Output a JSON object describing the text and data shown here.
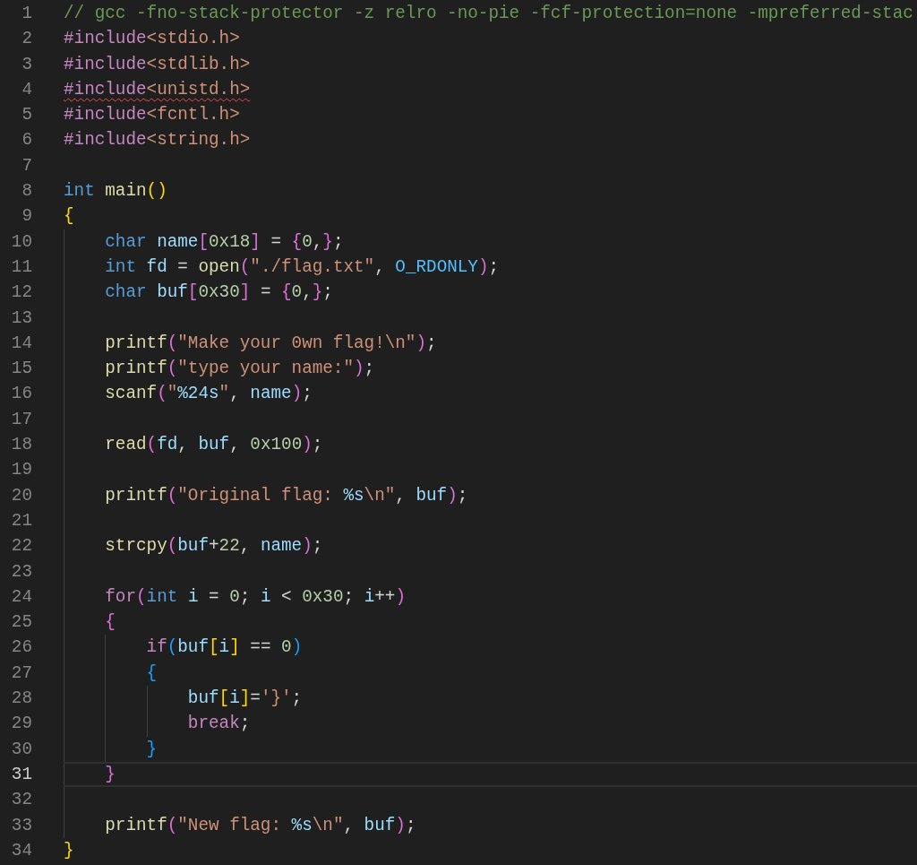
{
  "editor": {
    "lines": [
      {
        "number": "1",
        "current": false,
        "tokens": [
          {
            "kind": "comment",
            "text": "// gcc -fno-stack-protector -z relro -no-pie -fcf-protection=none -mpreferred-stac"
          }
        ]
      },
      {
        "number": "2",
        "current": false,
        "tokens": [
          {
            "kind": "directive",
            "text": "#include"
          },
          {
            "kind": "string",
            "text": "<stdio.h>"
          }
        ]
      },
      {
        "number": "3",
        "current": false,
        "tokens": [
          {
            "kind": "directive",
            "text": "#include"
          },
          {
            "kind": "string",
            "text": "<stdlib.h>"
          }
        ]
      },
      {
        "number": "4",
        "current": false,
        "tokens": [
          {
            "kind": "directive",
            "text": "#include",
            "error": true
          },
          {
            "kind": "string",
            "text": "<unistd.h>",
            "error": true
          }
        ]
      },
      {
        "number": "5",
        "current": false,
        "tokens": [
          {
            "kind": "directive",
            "text": "#include"
          },
          {
            "kind": "string",
            "text": "<fcntl.h>"
          }
        ]
      },
      {
        "number": "6",
        "current": false,
        "tokens": [
          {
            "kind": "directive",
            "text": "#include"
          },
          {
            "kind": "string",
            "text": "<string.h>"
          }
        ]
      },
      {
        "number": "7",
        "current": false
      },
      {
        "number": "8",
        "current": false,
        "tokens": [
          {
            "kind": "type",
            "text": "int "
          },
          {
            "kind": "function",
            "text": "main"
          },
          {
            "kind": "bracket1",
            "text": "()"
          }
        ]
      },
      {
        "number": "9",
        "current": false,
        "tokens": [
          {
            "kind": "bracket1",
            "text": "{"
          }
        ]
      },
      {
        "number": "10",
        "current": false,
        "tokens": [
          {
            "kind": "type",
            "text": "    char "
          },
          {
            "kind": "variable",
            "text": "name"
          },
          {
            "kind": "bracket2",
            "text": "["
          },
          {
            "kind": "number",
            "text": "0x18"
          },
          {
            "kind": "bracket2",
            "text": "]"
          },
          {
            "kind": "plain",
            "text": " = "
          },
          {
            "kind": "bracket2",
            "text": "{"
          },
          {
            "kind": "number",
            "text": "0"
          },
          {
            "kind": "plain",
            "text": ","
          },
          {
            "kind": "bracket2",
            "text": "}"
          },
          {
            "kind": "plain",
            "text": ";"
          }
        ]
      },
      {
        "number": "11",
        "current": false,
        "tokens": [
          {
            "kind": "type",
            "text": "    int "
          },
          {
            "kind": "variable",
            "text": "fd"
          },
          {
            "kind": "plain",
            "text": " = "
          },
          {
            "kind": "function",
            "text": "open"
          },
          {
            "kind": "bracket2",
            "text": "("
          },
          {
            "kind": "string",
            "text": "\"./flag.txt\""
          },
          {
            "kind": "plain",
            "text": ", "
          },
          {
            "kind": "constant",
            "text": "O_RDONLY"
          },
          {
            "kind": "bracket2",
            "text": ")"
          },
          {
            "kind": "plain",
            "text": ";"
          }
        ]
      },
      {
        "number": "12",
        "current": false,
        "tokens": [
          {
            "kind": "type",
            "text": "    char "
          },
          {
            "kind": "variable",
            "text": "buf"
          },
          {
            "kind": "bracket2",
            "text": "["
          },
          {
            "kind": "number",
            "text": "0x30"
          },
          {
            "kind": "bracket2",
            "text": "]"
          },
          {
            "kind": "plain",
            "text": " = "
          },
          {
            "kind": "bracket2",
            "text": "{"
          },
          {
            "kind": "number",
            "text": "0"
          },
          {
            "kind": "plain",
            "text": ","
          },
          {
            "kind": "bracket2",
            "text": "}"
          },
          {
            "kind": "plain",
            "text": ";"
          }
        ]
      },
      {
        "number": "13",
        "current": false
      },
      {
        "number": "14",
        "current": false,
        "tokens": [
          {
            "kind": "function",
            "text": "    printf"
          },
          {
            "kind": "bracket2",
            "text": "("
          },
          {
            "kind": "string",
            "text": "\"Make your 0wn flag!\\n\""
          },
          {
            "kind": "bracket2",
            "text": ")"
          },
          {
            "kind": "plain",
            "text": ";"
          }
        ]
      },
      {
        "number": "15",
        "current": false,
        "tokens": [
          {
            "kind": "function",
            "text": "    printf"
          },
          {
            "kind": "bracket2",
            "text": "("
          },
          {
            "kind": "string",
            "text": "\"type your name:\""
          },
          {
            "kind": "bracket2",
            "text": ")"
          },
          {
            "kind": "plain",
            "text": ";"
          }
        ]
      },
      {
        "number": "16",
        "current": false,
        "tokens": [
          {
            "kind": "function",
            "text": "    scanf"
          },
          {
            "kind": "bracket2",
            "text": "("
          },
          {
            "kind": "string",
            "text": "\""
          },
          {
            "kind": "format",
            "text": "%24s"
          },
          {
            "kind": "string",
            "text": "\""
          },
          {
            "kind": "plain",
            "text": ", "
          },
          {
            "kind": "variable",
            "text": "name"
          },
          {
            "kind": "bracket2",
            "text": ")"
          },
          {
            "kind": "plain",
            "text": ";"
          }
        ]
      },
      {
        "number": "17",
        "current": false
      },
      {
        "number": "18",
        "current": false,
        "tokens": [
          {
            "kind": "function",
            "text": "    read"
          },
          {
            "kind": "bracket2",
            "text": "("
          },
          {
            "kind": "variable",
            "text": "fd"
          },
          {
            "kind": "plain",
            "text": ", "
          },
          {
            "kind": "variable",
            "text": "buf"
          },
          {
            "kind": "plain",
            "text": ", "
          },
          {
            "kind": "number",
            "text": "0x100"
          },
          {
            "kind": "bracket2",
            "text": ")"
          },
          {
            "kind": "plain",
            "text": ";"
          }
        ]
      },
      {
        "number": "19",
        "current": false
      },
      {
        "number": "20",
        "current": false,
        "tokens": [
          {
            "kind": "function",
            "text": "    printf"
          },
          {
            "kind": "bracket2",
            "text": "("
          },
          {
            "kind": "string",
            "text": "\"Original flag: "
          },
          {
            "kind": "format",
            "text": "%s"
          },
          {
            "kind": "string",
            "text": "\\n\""
          },
          {
            "kind": "plain",
            "text": ", "
          },
          {
            "kind": "variable",
            "text": "buf"
          },
          {
            "kind": "bracket2",
            "text": ")"
          },
          {
            "kind": "plain",
            "text": ";"
          }
        ]
      },
      {
        "number": "21",
        "current": false
      },
      {
        "number": "22",
        "current": false,
        "tokens": [
          {
            "kind": "function",
            "text": "    strcpy"
          },
          {
            "kind": "bracket2",
            "text": "("
          },
          {
            "kind": "variable",
            "text": "buf"
          },
          {
            "kind": "plain",
            "text": "+"
          },
          {
            "kind": "number",
            "text": "22"
          },
          {
            "kind": "plain",
            "text": ", "
          },
          {
            "kind": "variable",
            "text": "name"
          },
          {
            "kind": "bracket2",
            "text": ")"
          },
          {
            "kind": "plain",
            "text": ";"
          }
        ]
      },
      {
        "number": "23",
        "current": false
      },
      {
        "number": "24",
        "current": false,
        "tokens": [
          {
            "kind": "control",
            "text": "    for"
          },
          {
            "kind": "bracket2",
            "text": "("
          },
          {
            "kind": "type",
            "text": "int "
          },
          {
            "kind": "variable",
            "text": "i"
          },
          {
            "kind": "plain",
            "text": " = "
          },
          {
            "kind": "number",
            "text": "0"
          },
          {
            "kind": "plain",
            "text": "; "
          },
          {
            "kind": "variable",
            "text": "i"
          },
          {
            "kind": "plain",
            "text": " < "
          },
          {
            "kind": "number",
            "text": "0x30"
          },
          {
            "kind": "plain",
            "text": "; "
          },
          {
            "kind": "variable",
            "text": "i"
          },
          {
            "kind": "plain",
            "text": "++"
          },
          {
            "kind": "bracket2",
            "text": ")"
          }
        ]
      },
      {
        "number": "25",
        "current": false,
        "tokens": [
          {
            "kind": "bracket2",
            "text": "    {"
          }
        ]
      },
      {
        "number": "26",
        "current": false,
        "tokens": [
          {
            "kind": "control",
            "text": "        if"
          },
          {
            "kind": "bracket3",
            "text": "("
          },
          {
            "kind": "variable",
            "text": "buf"
          },
          {
            "kind": "bracket1",
            "text": "["
          },
          {
            "kind": "variable",
            "text": "i"
          },
          {
            "kind": "bracket1",
            "text": "]"
          },
          {
            "kind": "plain",
            "text": " == "
          },
          {
            "kind": "number",
            "text": "0"
          },
          {
            "kind": "bracket3",
            "text": ")"
          }
        ]
      },
      {
        "number": "27",
        "current": false,
        "tokens": [
          {
            "kind": "bracket3",
            "text": "        {"
          }
        ]
      },
      {
        "number": "28",
        "current": false,
        "tokens": [
          {
            "kind": "variable",
            "text": "            buf"
          },
          {
            "kind": "bracket1",
            "text": "["
          },
          {
            "kind": "variable",
            "text": "i"
          },
          {
            "kind": "bracket1",
            "text": "]"
          },
          {
            "kind": "plain",
            "text": "="
          },
          {
            "kind": "string",
            "text": "'}'"
          },
          {
            "kind": "plain",
            "text": ";"
          }
        ]
      },
      {
        "number": "29",
        "current": false,
        "tokens": [
          {
            "kind": "control",
            "text": "            break"
          },
          {
            "kind": "plain",
            "text": ";"
          }
        ]
      },
      {
        "number": "30",
        "current": false,
        "tokens": [
          {
            "kind": "bracket3",
            "text": "        }"
          }
        ]
      },
      {
        "number": "31",
        "current": true,
        "tokens": [
          {
            "kind": "bracket2",
            "text": "    }"
          }
        ]
      },
      {
        "number": "32",
        "current": false
      },
      {
        "number": "33",
        "current": false,
        "tokens": [
          {
            "kind": "function",
            "text": "    printf"
          },
          {
            "kind": "bracket2",
            "text": "("
          },
          {
            "kind": "string",
            "text": "\"New flag: "
          },
          {
            "kind": "format",
            "text": "%s"
          },
          {
            "kind": "string",
            "text": "\\n\""
          },
          {
            "kind": "plain",
            "text": ", "
          },
          {
            "kind": "variable",
            "text": "buf"
          },
          {
            "kind": "bracket2",
            "text": ")"
          },
          {
            "kind": "plain",
            "text": ";"
          }
        ]
      },
      {
        "number": "34",
        "current": false,
        "tokens": [
          {
            "kind": "bracket1",
            "text": "}"
          }
        ]
      }
    ]
  }
}
